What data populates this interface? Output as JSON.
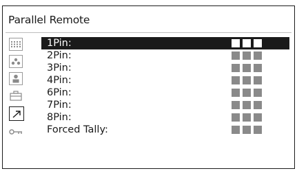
{
  "header": {
    "title": "Parallel Remote"
  },
  "sidebar": {
    "icons": [
      {
        "name": "dotted-panel-icon"
      },
      {
        "name": "people-icon"
      },
      {
        "name": "person-icon"
      },
      {
        "name": "briefcase-icon"
      },
      {
        "name": "arrow-icon"
      },
      {
        "name": "key-icon"
      }
    ]
  },
  "pins": [
    {
      "label": "1Pin:",
      "selected": true
    },
    {
      "label": "2Pin:",
      "selected": false
    },
    {
      "label": "3Pin:",
      "selected": false
    },
    {
      "label": "4Pin:",
      "selected": false
    },
    {
      "label": "6Pin:",
      "selected": false
    },
    {
      "label": "7Pin:",
      "selected": false
    },
    {
      "label": "8Pin:",
      "selected": false
    },
    {
      "label": "Forced Tally:",
      "selected": false
    }
  ],
  "colors": {
    "selected_bg": "#1a1a1a",
    "inactive_square": "#8a8a8a",
    "text": "#1a1a1a"
  }
}
